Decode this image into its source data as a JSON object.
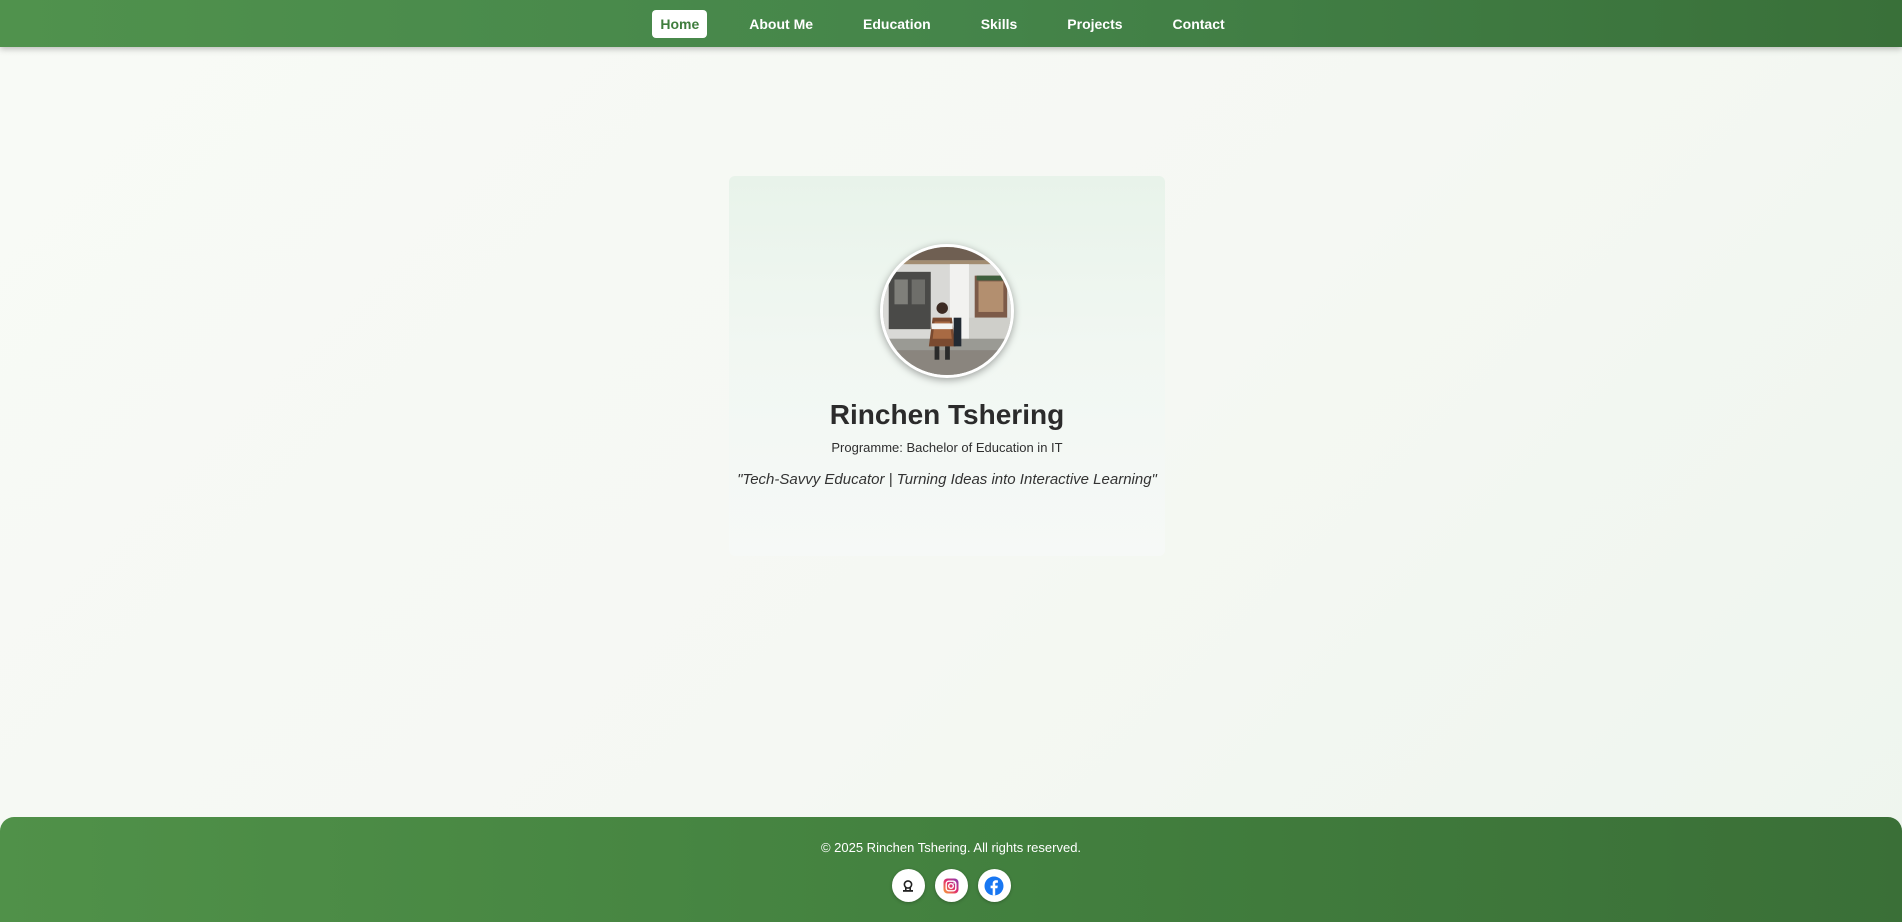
{
  "nav": {
    "items": [
      {
        "label": "Home",
        "active": true
      },
      {
        "label": "About Me",
        "active": false
      },
      {
        "label": "Education",
        "active": false
      },
      {
        "label": "Skills",
        "active": false
      },
      {
        "label": "Projects",
        "active": false
      },
      {
        "label": "Contact",
        "active": false
      }
    ]
  },
  "hero": {
    "name": "Rinchen Tshering",
    "programme": "Programme: Bachelor of Education in IT",
    "tagline": "\"Tech-Savvy Educator | Turning Ideas into Interactive Learning\""
  },
  "footer": {
    "copyright": "© 2025 Rinchen Tshering. All rights reserved.",
    "social": [
      {
        "icon": "github-icon"
      },
      {
        "icon": "instagram-icon"
      },
      {
        "icon": "facebook-icon"
      }
    ]
  },
  "colors": {
    "nav_bg": "#45854a",
    "active_text": "#3f7d3d",
    "footer_bg": "#43813f",
    "page_bg": "#f6f9f4",
    "facebook_blue": "#1877f2"
  }
}
